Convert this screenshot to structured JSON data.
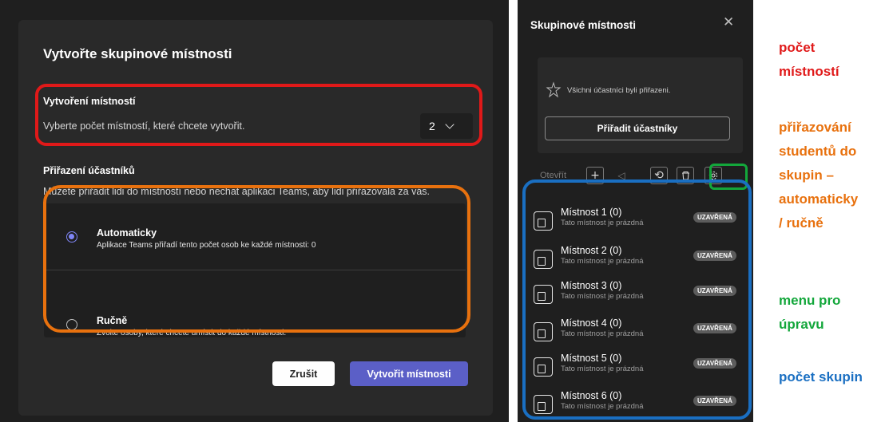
{
  "dialog": {
    "title": "Vytvořte skupinové místnosti",
    "rooms_section": {
      "heading": "Vytvoření místností",
      "description": "Vyberte počet místností, které chcete vytvořit.",
      "count_value": "2"
    },
    "assign_section": {
      "heading": "Přiřazení účastníků",
      "description": "Můžete přiřadit lidi do místností nebo nechat aplikaci Teams, aby lidi přiřazovala za vás.",
      "options": [
        {
          "label": "Automaticky",
          "description": "Aplikace Teams přiřadí tento počet osob ke každé místnosti: 0",
          "selected": true
        },
        {
          "label": "Ručně",
          "description": "Zvolte osoby, které chcete umístit do každé místnosti.",
          "selected": false
        }
      ]
    },
    "cancel_label": "Zrušit",
    "create_label": "Vytvořit místnosti"
  },
  "panel": {
    "title": "Skupinové místnosti",
    "close_icon": "close-icon",
    "assigned_message": "Všichni účastníci byli přiřazeni.",
    "assign_button": "Přiřadit účastníky",
    "toolbar": {
      "open_label": "Otevřít",
      "icons": [
        "add-icon",
        "announcement-icon",
        "recreate-icon",
        "delete-icon",
        "settings-icon"
      ]
    },
    "rooms": [
      {
        "name": "Místnost 1 (0)",
        "status": "Tato místnost je prázdná",
        "badge": "UZAVŘENÁ"
      },
      {
        "name": "Místnost 2 (0)",
        "status": "Tato místnost je prázdná",
        "badge": "UZAVŘENÁ"
      },
      {
        "name": "Místnost 3 (0)",
        "status": "Tato místnost je prázdná",
        "badge": "UZAVŘENÁ"
      },
      {
        "name": "Místnost 4 (0)",
        "status": "Tato místnost je prázdná",
        "badge": "UZAVŘENÁ"
      },
      {
        "name": "Místnost 5 (0)",
        "status": "Tato místnost je prázdná",
        "badge": "UZAVŘENÁ"
      },
      {
        "name": "Místnost 6 (0)",
        "status": "Tato místnost je prázdná",
        "badge": "UZAVŘENÁ"
      }
    ]
  },
  "annotations": {
    "red": [
      "počet",
      "místností"
    ],
    "orange": [
      "přiřazování",
      "studentů do",
      "skupin –",
      "automaticky",
      "/ ručně"
    ],
    "green": [
      "menu pro",
      "úpravu"
    ],
    "blue": [
      "počet skupin"
    ]
  },
  "colors": {
    "red": "#e01919",
    "orange": "#e8710e",
    "green": "#13a73b",
    "blue": "#1a6fc2",
    "accent": "#5b5fc7"
  }
}
